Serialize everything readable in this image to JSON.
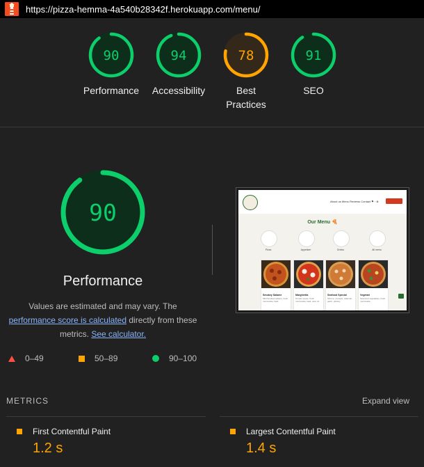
{
  "browser": {
    "url": "https://pizza-hemma-4a540b28342f.herokuapp.com/menu/"
  },
  "categories": [
    {
      "label": "Performance",
      "score": 90,
      "status": "pass"
    },
    {
      "label": "Accessibility",
      "score": 94,
      "status": "pass"
    },
    {
      "label": "Best Practices",
      "score": 78,
      "status": "average"
    },
    {
      "label": "SEO",
      "score": 91,
      "status": "pass"
    }
  ],
  "colors": {
    "pass": "#0cce6b",
    "pass_bg": "#0e2e1c",
    "average": "#ffa400",
    "average_bg": "#33281a",
    "fail": "#ff4e42"
  },
  "performance": {
    "score": 90,
    "title": "Performance",
    "desc_pre": "Values are estimated and may vary. The",
    "link1": "performance score is calculated",
    "desc_mid": "directly from these metrics.",
    "link2": "See calculator."
  },
  "legend": {
    "fail": "0–49",
    "average": "50–89",
    "pass": "90–100"
  },
  "screenshot": {
    "nav_links": "About us   Menu   Reviews   Contact   ⚑ ·   ⊕",
    "menu_title": "Our Menu 🍕",
    "categories": [
      "Pizza",
      "Appetizer",
      "Drinks",
      "All menu"
    ],
    "cards": [
      {
        "name": "Smokey Salame",
        "text": "Mild Smoked salame, fresh mozzarella, basil"
      },
      {
        "name": "Margherita",
        "text": "Tomato sauce, fresh mozzarella, basil, olive oil"
      },
      {
        "name": "Seafood Special",
        "text": "Shrimp, mussels, calamari, garlic, parsley"
      },
      {
        "name": "Vegetari",
        "text": "Seasonal vegetables, fresh mozzarella"
      }
    ]
  },
  "metrics": {
    "label": "METRICS",
    "expand": "Expand view",
    "items": [
      {
        "name": "First Contentful Paint",
        "value": "1.2 s"
      },
      {
        "name": "Largest Contentful Paint",
        "value": "1.4 s"
      }
    ]
  }
}
